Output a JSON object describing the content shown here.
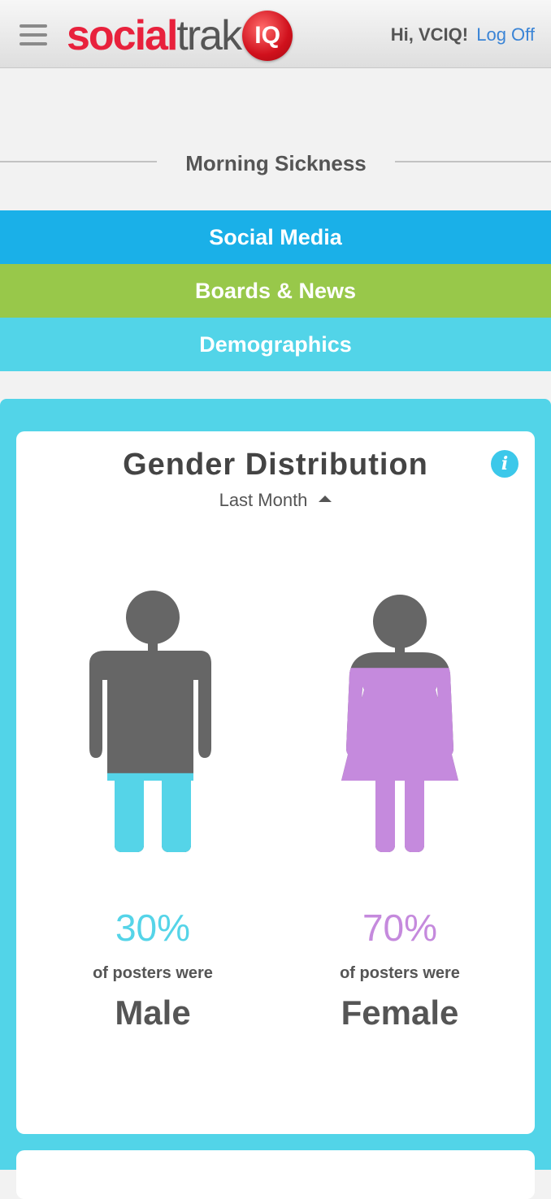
{
  "header": {
    "menu_icon": "hamburger-menu-icon",
    "logo": {
      "part1": "social",
      "part2": "trak",
      "badge": "IQ"
    },
    "greeting": "Hi, VCIQ!",
    "logoff": "Log Off"
  },
  "topic": {
    "title": "Morning Sickness"
  },
  "nav": [
    {
      "label": "Social Media",
      "color": "#1ab0e8"
    },
    {
      "label": "Boards & News",
      "color": "#98c84a"
    },
    {
      "label": "Demographics",
      "color": "#52d4e8"
    }
  ],
  "gender_card": {
    "title": "Gender Distribution",
    "info_icon": "info-icon",
    "period": "Last Month",
    "caret_icon": "caret-up-icon",
    "male": {
      "percent": "30%",
      "fraction": 0.3,
      "caption": "of posters were",
      "label": "Male",
      "color": "#55d4e8"
    },
    "female": {
      "percent": "70%",
      "fraction": 0.7,
      "caption": "of posters were",
      "label": "Female",
      "color": "#c58add"
    },
    "base_color": "#666666"
  }
}
